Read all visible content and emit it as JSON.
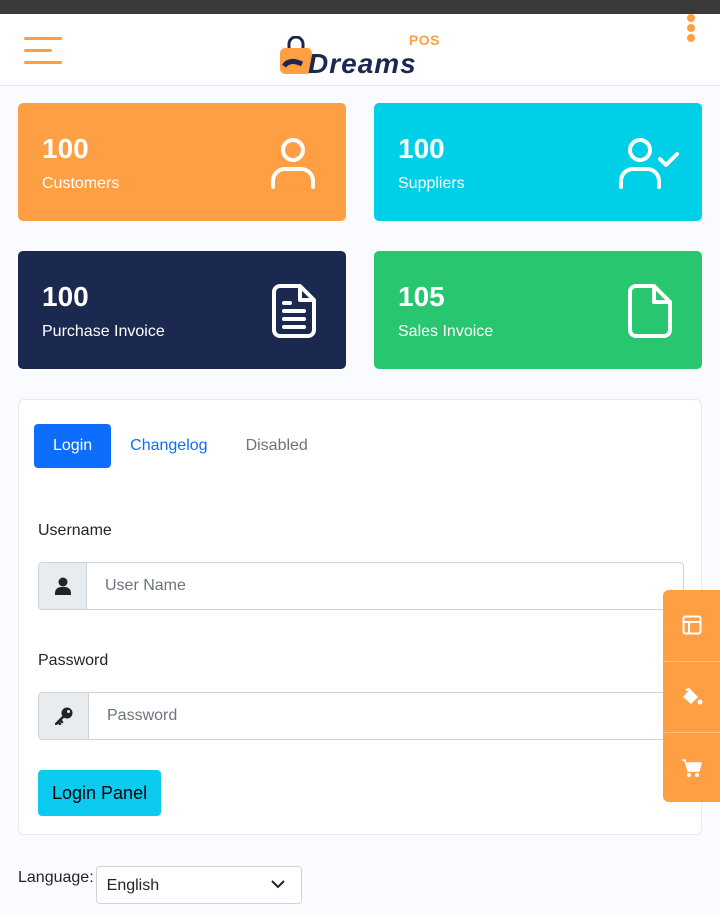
{
  "header": {
    "logo_text": "Dreams",
    "logo_suffix": "POS",
    "accent_color": "#ff9f43",
    "brand_color": "#1b2850",
    "menu_icon": "hamburger-icon",
    "more_icon": "kebab-icon"
  },
  "stats": [
    {
      "count": "100",
      "label": "Customers",
      "color": "#ff9f43",
      "icon": "user-icon"
    },
    {
      "count": "100",
      "label": "Suppliers",
      "color": "#00cfe8",
      "icon": "user-check-icon"
    },
    {
      "count": "100",
      "label": "Purchase Invoice",
      "color": "#1b2850",
      "icon": "file-text-icon"
    },
    {
      "count": "105",
      "label": "Sales Invoice",
      "color": "#28c76f",
      "icon": "file-icon"
    }
  ],
  "tabs": [
    {
      "label": "Login",
      "state": "active"
    },
    {
      "label": "Changelog",
      "state": "link"
    },
    {
      "label": "Disabled",
      "state": "disabled"
    }
  ],
  "form": {
    "username_label": "Username",
    "username_placeholder": "User Name",
    "username_value": "",
    "password_label": "Password",
    "password_placeholder": "Password",
    "password_value": "",
    "submit_label": "Login Panel"
  },
  "language": {
    "label": "Language:",
    "selected": "English"
  },
  "side_tools": [
    "layout-icon",
    "paint-bucket-icon",
    "cart-icon"
  ]
}
